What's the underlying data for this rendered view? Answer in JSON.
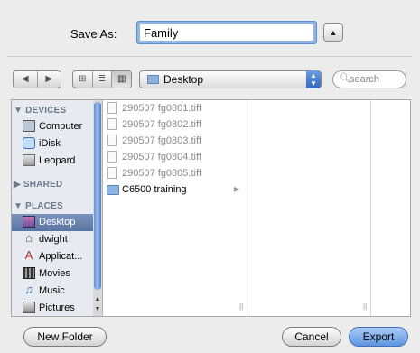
{
  "save_as": {
    "label": "Save As:",
    "value": "Family"
  },
  "toolbar": {
    "nav": {
      "back": "◀",
      "forward": "▶"
    },
    "views": {
      "icon": "⊞",
      "list": "≣",
      "column": "▥"
    },
    "location": "Desktop",
    "location_arrows": "▲▼",
    "search_placeholder": "search"
  },
  "sidebar": {
    "devices_heading": "▼ DEVICES",
    "devices": [
      "Computer",
      "iDisk",
      "Leopard"
    ],
    "shared_heading": "▶ SHARED",
    "places_heading": "▼ PLACES",
    "places": [
      "Desktop",
      "dwight",
      "Applicat...",
      "Movies",
      "Music",
      "Pictures"
    ]
  },
  "files": [
    "290507 fg0801.tiff",
    "290507 fg0802.tiff",
    "290507 fg0803.tiff",
    "290507 fg0804.tiff",
    "290507 fg0805.tiff"
  ],
  "folder": "C6500 training",
  "buttons": {
    "new_folder": "New Folder",
    "cancel": "Cancel",
    "export": "Export"
  },
  "colors": {
    "accent": "#5e95e1",
    "selection": "#5a74a2",
    "sidebar_bg": "#e7ebf1"
  }
}
